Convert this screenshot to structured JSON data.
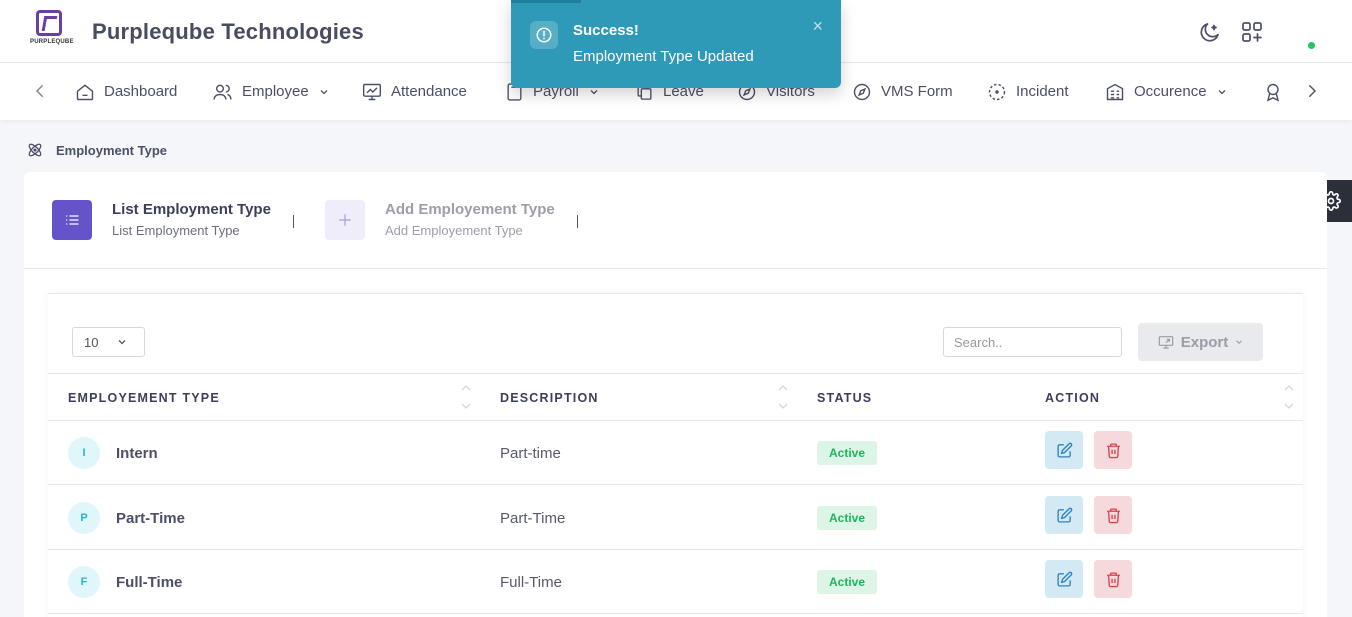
{
  "header": {
    "logo_text": "PURPLEQUBE",
    "company_name": "Purpleqube Technologies"
  },
  "toast": {
    "title": "Success!",
    "message": "Employment Type Updated",
    "close": "×"
  },
  "nav": {
    "items": [
      {
        "label": "Dashboard"
      },
      {
        "label": "Employee"
      },
      {
        "label": "Attendance"
      },
      {
        "label": "Payroll"
      },
      {
        "label": "Leave"
      },
      {
        "label": "Visitors"
      },
      {
        "label": "VMS Form"
      },
      {
        "label": "Incident"
      },
      {
        "label": "Occurence"
      }
    ]
  },
  "breadcrumb": {
    "label": "Employment Type"
  },
  "tabs": [
    {
      "title": "List Employment Type",
      "subtitle": "List Employment Type"
    },
    {
      "title": "Add Employement Type",
      "subtitle": "Add Employement Type"
    }
  ],
  "table": {
    "page_length": "10",
    "search_placeholder": "Search..",
    "export_label": "Export",
    "columns": [
      "EMPLOYEMENT TYPE",
      "DESCRIPTION",
      "STATUS",
      "ACTION"
    ],
    "rows": [
      {
        "initial": "I",
        "type": "Intern",
        "description": "Part-time",
        "status": "Active"
      },
      {
        "initial": "P",
        "type": "Part-Time",
        "description": "Part-Time",
        "status": "Active"
      },
      {
        "initial": "F",
        "type": "Full-Time",
        "description": "Full-Time",
        "status": "Active"
      }
    ]
  },
  "colors": {
    "accent": "#6553c9",
    "toast": "#2e9ab8",
    "active_badge": "#22b35e"
  }
}
